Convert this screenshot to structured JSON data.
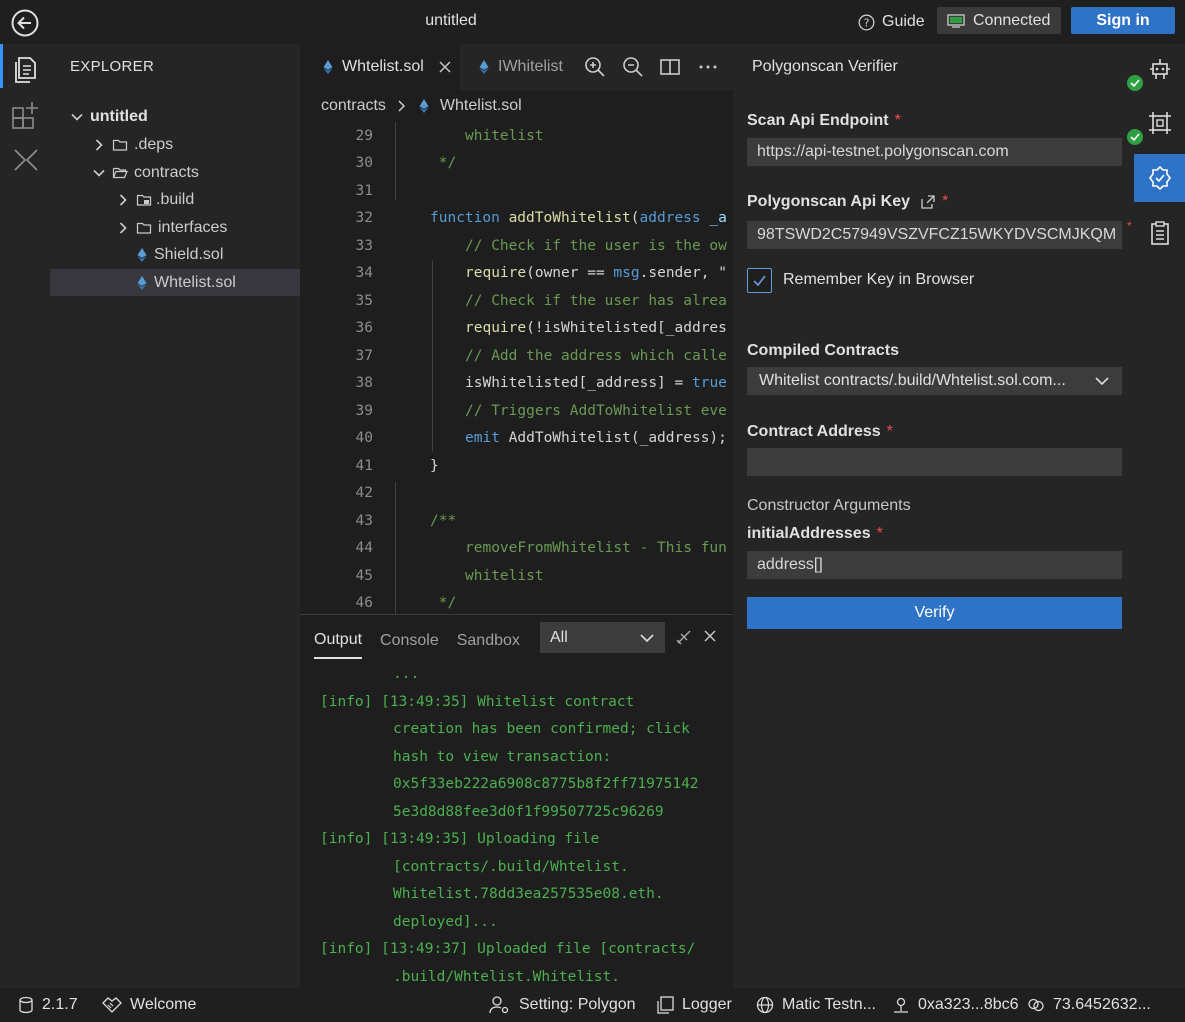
{
  "window": {
    "title": "untitled"
  },
  "titlebar": {
    "guide": "Guide",
    "connected": "Connected",
    "signin": "Sign in"
  },
  "explorer": {
    "title": "EXPLORER",
    "items": [
      {
        "label": "untitled",
        "type": "root"
      },
      {
        "label": ".deps",
        "type": "folder"
      },
      {
        "label": "contracts",
        "type": "folder-open"
      },
      {
        "label": ".build",
        "type": "folder"
      },
      {
        "label": "interfaces",
        "type": "folder"
      },
      {
        "label": "Shield.sol",
        "type": "file"
      },
      {
        "label": "Whtelist.sol",
        "type": "file"
      }
    ]
  },
  "editor": {
    "tabs": [
      {
        "label": "Whtelist.sol"
      },
      {
        "label": "IWhitelist"
      }
    ],
    "breadcrumb": {
      "folder": "contracts",
      "file": "Whtelist.sol"
    },
    "lines": [
      {
        "n": "29",
        "text": "whitelist"
      },
      {
        "n": "30",
        "text": " */"
      },
      {
        "n": "31",
        "text": ""
      },
      {
        "n": "32",
        "kw": "function",
        "fn": " addToWhitelist",
        "pl": "(",
        "kw2": "address",
        "rest": " _a"
      },
      {
        "n": "33",
        "text": "// Check if the user is the ow"
      },
      {
        "n": "34",
        "fn": "require",
        "pl": "(owner == ",
        "kw": "msg",
        "rest": ".sender, \""
      },
      {
        "n": "35",
        "text": "// Check if the user has alrea"
      },
      {
        "n": "36",
        "fn": "require",
        "pl": "(!isWhitelisted[_addres"
      },
      {
        "n": "37",
        "text": "// Add the address which calle"
      },
      {
        "n": "38",
        "pl": "isWhitelisted[_address] = ",
        "kw": "true"
      },
      {
        "n": "39",
        "text": "// Triggers AddToWhitelist eve"
      },
      {
        "n": "40",
        "kw": "emit",
        "pl": " AddToWhitelist(_address);"
      },
      {
        "n": "41",
        "text": "}"
      },
      {
        "n": "42",
        "text": ""
      },
      {
        "n": "43",
        "text": "/**"
      },
      {
        "n": "44",
        "text": "removeFromWhitelist - This fun"
      },
      {
        "n": "45",
        "text": "whitelist"
      },
      {
        "n": "46",
        "text": " */"
      }
    ]
  },
  "panel": {
    "tabs": [
      "Output",
      "Console",
      "Sandbox"
    ],
    "filter": "All",
    "log": [
      "...",
      "[info] [13:49:35] Whitelist contract",
      "creation has been confirmed; click",
      "hash to view transaction:",
      "0x5f33eb222a6908c8775b8f2ff71975142",
      "5e3d8d88fee3d0f1f99507725c96269",
      "[info] [13:49:35] Uploading file",
      "[contracts/.build/Whtelist.",
      "Whitelist.78dd3ea257535e08.eth.",
      "deployed]...",
      "[info] [13:49:37] Uploaded file [contracts/",
      ".build/Whtelist.Whitelist."
    ]
  },
  "verifier": {
    "title": "Polygonscan Verifier",
    "endpoint_label": "Scan Api Endpoint",
    "endpoint_value": "https://api-testnet.polygonscan.com",
    "apikey_label": "Polygonscan Api Key",
    "apikey_value": "98TSWD2C57949VSZVFCZ15WKYDVSCMJKQM",
    "remember_label": "Remember Key in Browser",
    "remember_checked": true,
    "compiled_label": "Compiled Contracts",
    "compiled_value": "Whitelist contracts/.build/Whtelist.sol.com...",
    "address_label": "Contract Address",
    "address_value": "",
    "ctor_label": "Constructor Arguments",
    "ctor_param_label": "initialAddresses",
    "ctor_param_placeholder": "address[]",
    "required_mark": "*",
    "verify_label": "Verify"
  },
  "statusbar": {
    "version": "2.1.7",
    "welcome": "Welcome",
    "setting": "Setting: Polygon",
    "logger": "Logger",
    "network": "Matic Testn...",
    "account": "0xa323...8bc6",
    "balance": "73.6452632..."
  },
  "colors": {
    "accent": "#2f73c7",
    "success": "#2ea043",
    "log_green": "#4caf50"
  }
}
